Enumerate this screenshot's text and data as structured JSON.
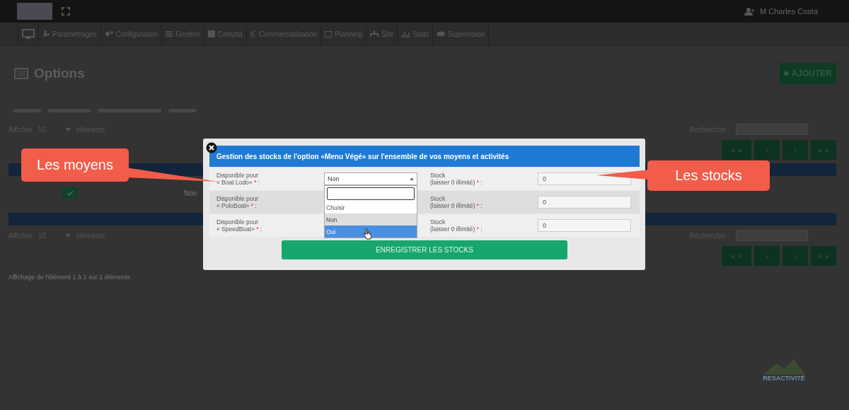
{
  "top_bar": {
    "user": "M Charles Costa"
  },
  "nav": [
    {
      "label": "Paramétrages"
    },
    {
      "label": "Configuration"
    },
    {
      "label": "Gestion"
    },
    {
      "label": "Compta"
    },
    {
      "label": "Commercialisation"
    },
    {
      "label": "Planning"
    },
    {
      "label": "Site"
    },
    {
      "label": "Stats"
    },
    {
      "label": "Supervision"
    }
  ],
  "page": {
    "title": "Options",
    "add_button": "AJOUTER",
    "top_controls": {
      "show_label": "Afficher",
      "show_value": "10",
      "show_suffix": "éléments",
      "search_label": "Rechercher :"
    },
    "pagination": [
      "« «",
      "‹",
      "›",
      "» »"
    ],
    "row": {
      "cell": "Non"
    },
    "bottom_controls": {
      "show_label": "Afficher",
      "show_value": "10",
      "show_suffix": "éléments",
      "search_label": "Rechercher :"
    },
    "info": "Affichage de l'élément 1 à 1 sur 1 éléments"
  },
  "modal": {
    "title": "Gestion des stocks de l'option «Menu Végé» sur l'ensemble de vos moyens et activités",
    "rows": [
      {
        "label": "Disponible pour",
        "name": "« Boat Lodo»",
        "required_mark": "*",
        "colon": ":",
        "select_value": "Non",
        "stock_label": "Stock",
        "stock_hint": "(laisser 0 illimité)",
        "stock_required_mark": "*",
        "stock_colon": ":",
        "stock_value": "0"
      },
      {
        "label": "Disponible pour",
        "name": "« PoloBoat»",
        "required_mark": "*",
        "colon": ":",
        "stock_label": "Stock",
        "stock_hint": "(laisser 0 illimité)",
        "stock_required_mark": "*",
        "stock_colon": ":",
        "stock_value": "0"
      },
      {
        "label": "Disponible pour",
        "name": "« SpeedBoat»",
        "required_mark": "*",
        "colon": ":",
        "stock_label": "Stock",
        "stock_hint": "(laisser 0 illimité)",
        "stock_required_mark": "*",
        "stock_colon": ":",
        "stock_value": "0"
      }
    ],
    "dropdown": {
      "options": [
        {
          "label": "Choisir",
          "selected": false,
          "highlighted": false
        },
        {
          "label": "Non",
          "selected": true,
          "highlighted": false
        },
        {
          "label": "Oui",
          "selected": false,
          "highlighted": true
        }
      ]
    },
    "save_button": "ENREGISTRER LES STOCKS"
  },
  "callouts": [
    {
      "text": "Les moyens"
    },
    {
      "text": "Les stocks"
    }
  ],
  "footer_logo": "RESACTIVITÉ"
}
